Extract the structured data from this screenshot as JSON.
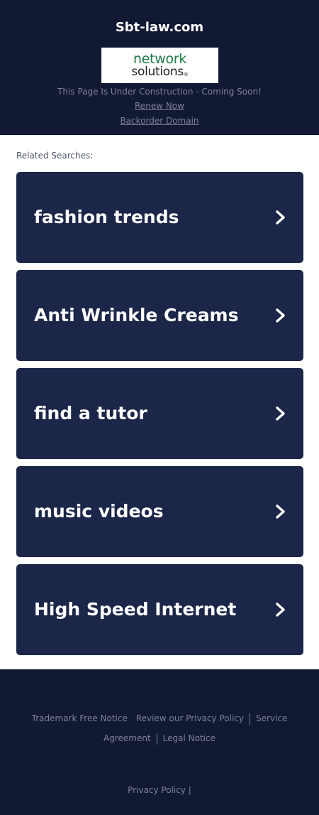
{
  "header": {
    "site_title": "Sbt-law.com",
    "logo": {
      "line1": "network",
      "line2": "solutions",
      "trademark": "®",
      "accent_color": "#1e7a44"
    },
    "construction_text": "This Page Is Under Construction - Coming Soon!",
    "renew_link": "Renew Now",
    "backorder_link": "Backorder Domain"
  },
  "related": {
    "label": "Related Searches:",
    "items": [
      {
        "label": "fashion trends",
        "icon": "chevron-right-icon"
      },
      {
        "label": "Anti Wrinkle Creams",
        "icon": "chevron-right-icon"
      },
      {
        "label": "find a tutor",
        "icon": "chevron-right-icon"
      },
      {
        "label": "music videos",
        "icon": "chevron-right-icon"
      },
      {
        "label": "High Speed Internet",
        "icon": "chevron-right-icon"
      }
    ]
  },
  "footer": {
    "trademark_notice": "Trademark Free Notice",
    "privacy_review": "Review our Privacy Policy",
    "service_agreement": "Service Agreement",
    "legal_notice": "Legal Notice",
    "privacy_policy": "Privacy Policy",
    "trailing_separator": "|"
  },
  "colors": {
    "header_bg": "#121a33",
    "card_bg": "#1b2648",
    "muted_text": "#7d8197"
  }
}
